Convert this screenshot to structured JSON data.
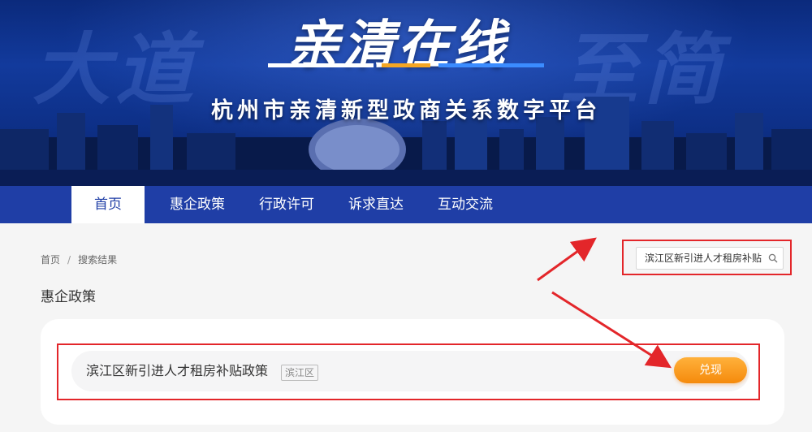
{
  "banner": {
    "ghost_left": "大道",
    "ghost_right": "至简",
    "logo": "亲清在线",
    "subtitle": "杭州市亲清新型政商关系数字平台"
  },
  "nav": {
    "items": [
      {
        "label": "首页",
        "active": true
      },
      {
        "label": "惠企政策"
      },
      {
        "label": "行政许可"
      },
      {
        "label": "诉求直达"
      },
      {
        "label": "互动交流"
      }
    ]
  },
  "breadcrumb": {
    "home": "首页",
    "separator": "/",
    "current": "搜索结果"
  },
  "search": {
    "value": "滨江区新引进人才租房补贴",
    "icon": "search-icon"
  },
  "section": {
    "title": "惠企政策"
  },
  "results": [
    {
      "title": "滨江区新引进人才租房补贴政策",
      "tag": "滨江区",
      "action": "兑现"
    }
  ],
  "colors": {
    "nav_bg": "#1f3ea6",
    "annotation_red": "#e3262a",
    "button_orange": "#f58a0c"
  }
}
